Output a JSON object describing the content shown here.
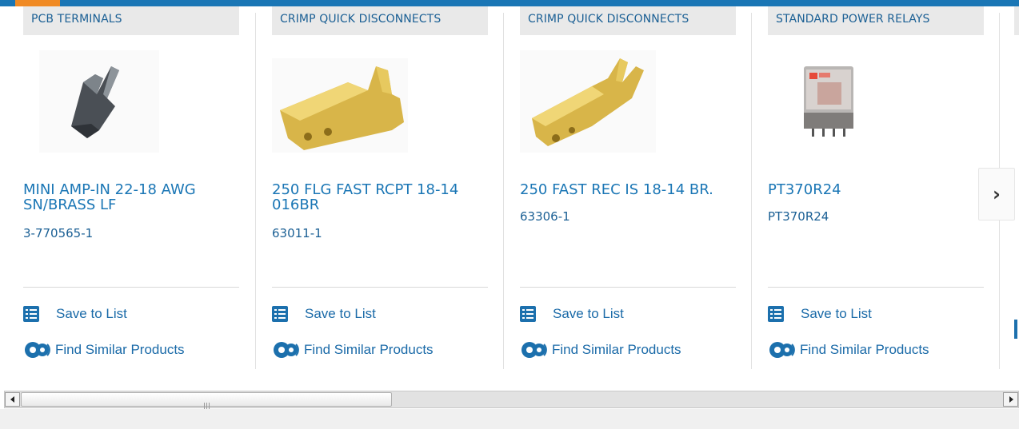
{
  "products": [
    {
      "category": "PCB TERMINALS",
      "title": "MINI AMP-IN 22-18 AWG SN/BRASS LF",
      "part_number": "3-770565-1",
      "save_label": "Save to List",
      "similar_label": "Find Similar Products",
      "image": "pcb-terminal-image"
    },
    {
      "category": "CRIMP QUICK DISCONNECTS",
      "title": "250 FLG FAST RCPT 18-14 016BR",
      "part_number": "63011-1",
      "save_label": "Save to List",
      "similar_label": "Find Similar Products",
      "image": "flag-receptacle-image"
    },
    {
      "category": "CRIMP QUICK DISCONNECTS",
      "title": "250 FAST REC IS 18-14 BR.",
      "part_number": "63306-1",
      "save_label": "Save to List",
      "similar_label": "Find Similar Products",
      "image": "fast-receptacle-image"
    },
    {
      "category": "STANDARD POWER RELAYS",
      "title": "PT370R24",
      "part_number": "PT370R24",
      "save_label": "Save to List",
      "similar_label": "Find Similar Products",
      "image": "power-relay-image"
    }
  ],
  "carousel": {
    "next_icon": "chevron-right-icon",
    "next_glyph": "›"
  },
  "colors": {
    "brand_blue": "#1a76b5",
    "accent_orange": "#f08a24",
    "link_blue": "#1a6aa8"
  }
}
